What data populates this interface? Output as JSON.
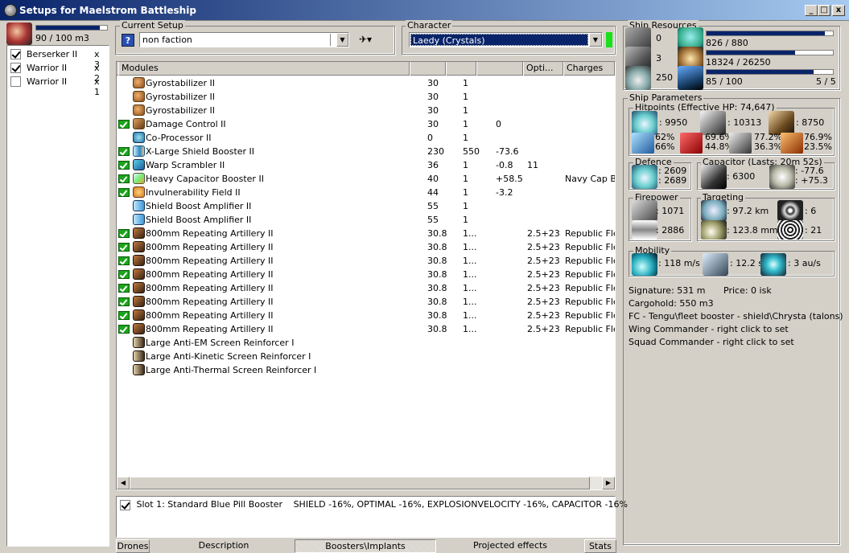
{
  "window": {
    "title": "Setups for Maelstrom Battleship",
    "minimize_label": "_",
    "maximize_label": "□",
    "close_label": "x"
  },
  "drones_panel": {
    "bandwidth": "90 / 100 m3",
    "bandwidth_fill": 0.9,
    "items": [
      {
        "label": "Berserker II",
        "count": "x 3",
        "checked": true
      },
      {
        "label": "Warrior II",
        "count": "x 2",
        "checked": true
      },
      {
        "label": "Warrior II",
        "count": "x 1",
        "checked": false
      }
    ]
  },
  "current_setup": {
    "label": "Current Setup",
    "value": "non faction"
  },
  "character": {
    "label": "Character",
    "value": "Laedy (Crystals)"
  },
  "modules": {
    "headers": [
      "Modules",
      "",
      "",
      "",
      "Opti...",
      "Charges"
    ],
    "rows": [
      {
        "name": "Gyrostabilizer II",
        "icon": "gyrostabilizer-icon",
        "ic": "ic-gyro",
        "check": false,
        "c1": "30",
        "c2": "1",
        "c3": "",
        "opt": "",
        "charge": ""
      },
      {
        "name": "Gyrostabilizer II",
        "icon": "gyrostabilizer-icon",
        "ic": "ic-gyro",
        "check": false,
        "c1": "30",
        "c2": "1",
        "c3": "",
        "opt": "",
        "charge": ""
      },
      {
        "name": "Gyrostabilizer II",
        "icon": "gyrostabilizer-icon",
        "ic": "ic-gyro",
        "check": false,
        "c1": "30",
        "c2": "1",
        "c3": "",
        "opt": "",
        "charge": ""
      },
      {
        "name": "Damage Control II",
        "icon": "damage-control-icon",
        "ic": "ic-dc",
        "check": true,
        "c1": "30",
        "c2": "1",
        "c3": "0",
        "opt": "",
        "charge": ""
      },
      {
        "name": "Co-Processor II",
        "icon": "coprocessor-icon",
        "ic": "ic-cpu",
        "check": false,
        "c1": "0",
        "c2": "1",
        "c3": "",
        "opt": "",
        "charge": ""
      },
      {
        "name": "X-Large Shield Booster II",
        "icon": "shield-booster-icon",
        "ic": "ic-shield",
        "check": true,
        "c1": "230",
        "c2": "550",
        "c3": "-73.6",
        "opt": "",
        "charge": ""
      },
      {
        "name": "Warp Scrambler II",
        "icon": "warp-scrambler-icon",
        "ic": "ic-scram",
        "check": true,
        "c1": "36",
        "c2": "1",
        "c3": "-0.8",
        "opt": "11",
        "charge": ""
      },
      {
        "name": "Heavy Capacitor Booster II",
        "icon": "capacitor-booster-icon",
        "ic": "ic-cap",
        "check": true,
        "c1": "40",
        "c2": "1",
        "c3": "+58.5",
        "opt": "",
        "charge": "Navy Cap Bo"
      },
      {
        "name": "Invulnerability Field II",
        "icon": "invulnerability-field-icon",
        "ic": "ic-invul",
        "check": true,
        "c1": "44",
        "c2": "1",
        "c3": "-3.2",
        "opt": "",
        "charge": ""
      },
      {
        "name": "Shield Boost Amplifier II",
        "icon": "shield-amplifier-icon",
        "ic": "ic-amp",
        "check": false,
        "c1": "55",
        "c2": "1",
        "c3": "",
        "opt": "",
        "charge": ""
      },
      {
        "name": "Shield Boost Amplifier II",
        "icon": "shield-amplifier-icon",
        "ic": "ic-amp",
        "check": false,
        "c1": "55",
        "c2": "1",
        "c3": "",
        "opt": "",
        "charge": ""
      },
      {
        "name": "800mm Repeating Artillery II",
        "icon": "artillery-icon",
        "ic": "ic-arty",
        "check": true,
        "c1": "30.8",
        "c2": "1...",
        "c3": "",
        "opt": "2.5+23",
        "charge": "Republic Flee"
      },
      {
        "name": "800mm Repeating Artillery II",
        "icon": "artillery-icon",
        "ic": "ic-arty",
        "check": true,
        "c1": "30.8",
        "c2": "1...",
        "c3": "",
        "opt": "2.5+23",
        "charge": "Republic Flee"
      },
      {
        "name": "800mm Repeating Artillery II",
        "icon": "artillery-icon",
        "ic": "ic-arty",
        "check": true,
        "c1": "30.8",
        "c2": "1...",
        "c3": "",
        "opt": "2.5+23",
        "charge": "Republic Flee"
      },
      {
        "name": "800mm Repeating Artillery II",
        "icon": "artillery-icon",
        "ic": "ic-arty",
        "check": true,
        "c1": "30.8",
        "c2": "1...",
        "c3": "",
        "opt": "2.5+23",
        "charge": "Republic Flee"
      },
      {
        "name": "800mm Repeating Artillery II",
        "icon": "artillery-icon",
        "ic": "ic-arty",
        "check": true,
        "c1": "30.8",
        "c2": "1...",
        "c3": "",
        "opt": "2.5+23",
        "charge": "Republic Flee"
      },
      {
        "name": "800mm Repeating Artillery II",
        "icon": "artillery-icon",
        "ic": "ic-arty",
        "check": true,
        "c1": "30.8",
        "c2": "1...",
        "c3": "",
        "opt": "2.5+23",
        "charge": "Republic Flee"
      },
      {
        "name": "800mm Repeating Artillery II",
        "icon": "artillery-icon",
        "ic": "ic-arty",
        "check": true,
        "c1": "30.8",
        "c2": "1...",
        "c3": "",
        "opt": "2.5+23",
        "charge": "Republic Flee"
      },
      {
        "name": "800mm Repeating Artillery II",
        "icon": "artillery-icon",
        "ic": "ic-arty",
        "check": true,
        "c1": "30.8",
        "c2": "1...",
        "c3": "",
        "opt": "2.5+23",
        "charge": "Republic Flee"
      },
      {
        "name": "Large Anti-EM Screen Reinforcer I",
        "icon": "rig-icon",
        "ic": "ic-rein",
        "check": false,
        "c1": "",
        "c2": "",
        "c3": "",
        "opt": "",
        "charge": ""
      },
      {
        "name": "Large Anti-Kinetic Screen Reinforcer I",
        "icon": "rig-icon",
        "ic": "ic-rein",
        "check": false,
        "c1": "",
        "c2": "",
        "c3": "",
        "opt": "",
        "charge": ""
      },
      {
        "name": "Large Anti-Thermal Screen Reinforcer I",
        "icon": "rig-icon",
        "ic": "ic-rein",
        "check": false,
        "c1": "",
        "c2": "",
        "c3": "",
        "opt": "",
        "charge": ""
      }
    ]
  },
  "boosters": {
    "slot_label": "Slot 1: Standard Blue Pill Booster",
    "effects": "SHIELD -16%, OPTIMAL -16%, EXPLOSIONVELOCITY -16%, CAPACITOR -16%"
  },
  "bottom_tabs": {
    "drones": "Drones",
    "description": "Description",
    "boosters": "Boosters\\Implants",
    "projected": "Projected effects",
    "stats": "Stats"
  },
  "ship_resources": {
    "label": "Ship Resources",
    "turrets": "0",
    "launchers": "3",
    "drone_bay": "250",
    "cpu": "826 / 880",
    "cpu_fill": 0.939,
    "powergrid": "18324 / 26250",
    "powergrid_fill": 0.698,
    "calibration": "85 / 100",
    "calibration_fill": 0.85,
    "rig_slots": "5 / 5"
  },
  "ship_parameters": {
    "label": "Ship Parameters",
    "hitpoints_label": "Hitpoints (Effective HP: 74,647)",
    "shield_hp": ": 9950",
    "armor_hp": ": 10313",
    "hull_hp": ": 8750",
    "shield_res": {
      "em": "62%",
      "th": "66%"
    },
    "armor_res": {
      "em": "69.6%",
      "th": "44.8%"
    },
    "armor_res2": {
      "a": "77.2%",
      "b": "36.3%"
    },
    "hull_res": {
      "a": "76.9%",
      "b": "23.5%"
    },
    "defence_label": "Defence",
    "defence_a": ": 2609",
    "defence_b": ": 2689",
    "capacitor_label": "Capacitor (Lasts: 20m 52s)",
    "capacitor_value": ": 6300",
    "cap_delta_a": ": -77.6",
    "cap_delta_b": ": +75.3",
    "firepower_label": "Firepower",
    "dps": ": 1071",
    "volley": ": 2886",
    "targeting_label": "Targeting",
    "target_range": ": 97.2 km",
    "max_targets": ": 6",
    "scan_res": ": 123.8 mm",
    "sensor_strength": ": 21",
    "mobility_label": "Mobility",
    "velocity": ": 118 m/s",
    "align_time": ": 12.2 s",
    "warp_speed": ": 3 au/s",
    "signature": "Signature: 531 m",
    "price": "Price: 0 isk",
    "cargohold": "Cargohold: 550 m3",
    "fleet_booster": "FC - Tengu\\fleet booster - shield\\Chrysta (talons)",
    "wing_commander": "Wing Commander - right click to set",
    "squad_commander": "Squad Commander - right click to set"
  }
}
